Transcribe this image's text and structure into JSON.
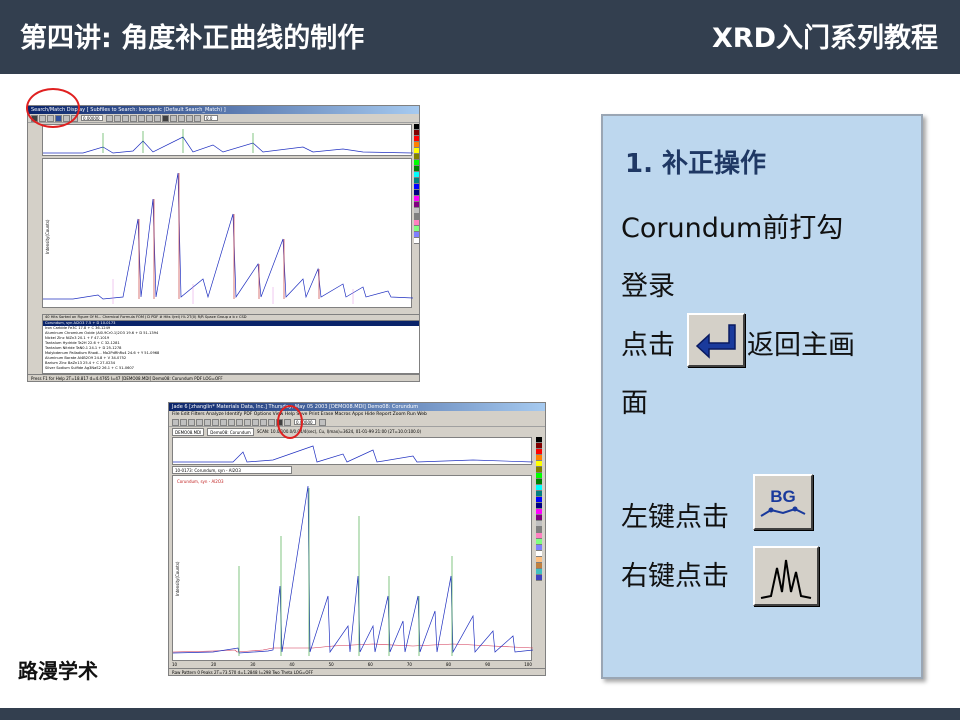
{
  "header": {
    "title": "第四讲: 角度补正曲线的制作",
    "series": "XRD入门系列教程"
  },
  "brand": "路漫学术",
  "panel": {
    "heading": "1. 补正操作",
    "lines": [
      "Corundum前打勾",
      "登录",
      "点击",
      "返回主画",
      "面",
      "左键点击",
      "右键点击"
    ]
  },
  "icons": {
    "return": "enter-return-icon",
    "background": "bg-icon",
    "peak": "peak-search-icon",
    "bg_label": "BG"
  },
  "screenshot1": {
    "titlebar": "Search/Match Display [ Subfiles to Search: Inorganic (Default Search_Match) ]",
    "toolbar_field": "0.00000",
    "toolbar_field2": "0.0",
    "ylabel": "Intensity(Counts)",
    "table_header": "40 Hits Sorted on Figure Of M...   Chemical Formula   FOM  J  D  PDF #  Hits  I(rel)  I%  2T(0)  R/R  Space Group  a  b  c  CSD",
    "rows": [
      "Corundum, syn                    Al2O3      7.5  +  D  10-0173",
      "Iron Carbide                     Fe3C       17.8  +  C  36-1249",
      "Aluminum Chromium Oxide          (Al0.9Cr0.1)2O3  19.6  +  D  51-1394",
      "Nickel Zinc                      NiZn3      20.1  +  F  47-1019",
      "Tantalum Hydride                 Ta2H       22.6  +  C  32-1281",
      "Tantalum Nitride                 TaN0.1     24.1  +  D  25-1278",
      "Molybdenum Palladium Rhodi...    Mo2PdRhRu4  24.6  +  Y  51-0968",
      "Aluminum Borate                  Al4B2O9    24.8  +  V  34-0752",
      "Barium Zinc                      BaZn13     25.4  +  C  27-0234",
      "Silver Sodium Sulfide            Ag3NaS2    26.1  +  C  51-0607"
    ],
    "status": "Press F1 for Help        2T=18.817   d=4.4765   I=47   [DEMO08.MDI] Demo08: Corundum        PDF   LOG=OFF"
  },
  "screenshot2": {
    "titlebar": "Jade 6 [zhanglin* Materials Data, Inc.] Thursday, May 05 2003 [DEMO08.MDI] Demo08: Corundum",
    "menubar": "File  Edit  Filters  Analyze  Identify  PDF  Options  View  Help  Save  Print  Erase  Macros  Apps  Hide  Report  Zoom  Run  Web",
    "toolbar_field": "0.00000",
    "file_field": "DEMO08.MDI",
    "file_field2": "Demo08: Corundum",
    "info_line": "SCAN: 10.0/100.0/0.04/4(sec), Cu, I(max)=3624, 01-01-99 21:00      (2T=10.0:100.0)",
    "pdf_field": "10-0173: Corundum, syn - Al2O3",
    "legend": "Corundum, syn - Al2O3",
    "ylabel": "Intensity(Counts)",
    "status": "Raw Pattern     0 Peaks     2T=73.570     d=1.2848     I=298     Two Theta        LOG=OFF",
    "xticks": [
      "10",
      "20",
      "30",
      "40",
      "50",
      "60",
      "70",
      "80",
      "90",
      "100"
    ]
  }
}
